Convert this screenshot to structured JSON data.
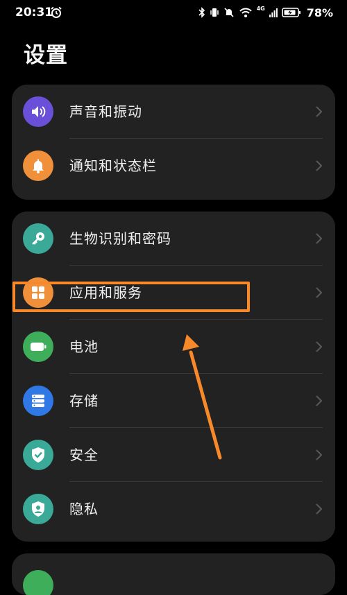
{
  "status_bar": {
    "time": "20:31",
    "icons": [
      "alarm-icon",
      "bluetooth-icon",
      "vibrate-icon",
      "mute-icon",
      "wifi-icon",
      "signal-icon",
      "battery-icon"
    ],
    "signal_label": "4G",
    "battery": "78%"
  },
  "page": {
    "title": "设置"
  },
  "groups": [
    {
      "items": [
        {
          "label": "声音和振动",
          "icon": "speaker-icon",
          "color": "#6a4fd8"
        },
        {
          "label": "通知和状态栏",
          "icon": "bell-icon",
          "color": "#f0903a"
        }
      ]
    },
    {
      "items": [
        {
          "label": "生物识别和密码",
          "icon": "key-icon",
          "color": "#3aa997"
        },
        {
          "label": "应用和服务",
          "icon": "apps-icon",
          "color": "#f0903a"
        },
        {
          "label": "电池",
          "icon": "battery-icon",
          "color": "#3fae5a"
        },
        {
          "label": "存储",
          "icon": "storage-icon",
          "color": "#2f78e6"
        },
        {
          "label": "安全",
          "icon": "shield-check-icon",
          "color": "#3aa997"
        },
        {
          "label": "隐私",
          "icon": "privacy-icon",
          "color": "#3aa997"
        }
      ]
    }
  ],
  "colors": {
    "highlight": "#f7892a",
    "background": "#000000",
    "card": "#222222"
  }
}
